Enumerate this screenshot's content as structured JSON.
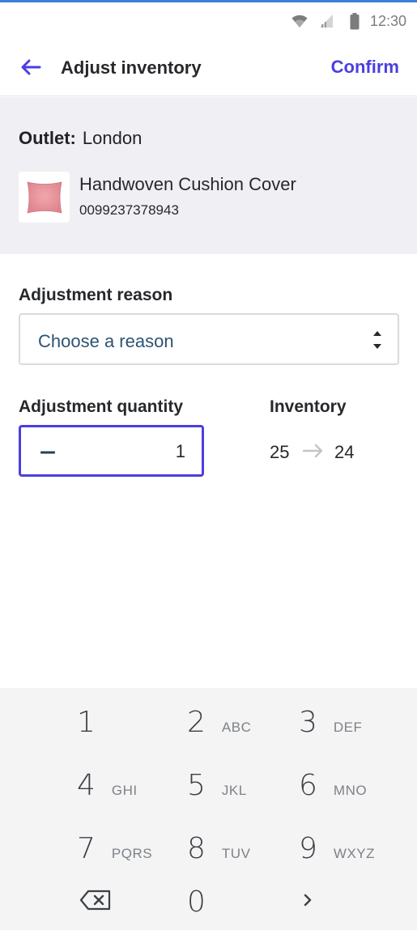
{
  "status_bar": {
    "time": "12:30",
    "icons": [
      "wifi-icon",
      "signal-icon",
      "battery-icon"
    ]
  },
  "app_bar": {
    "title": "Adjust inventory",
    "confirm_label": "Confirm",
    "back_icon": "back-arrow-icon"
  },
  "product": {
    "outlet_label": "Outlet:",
    "outlet_value": "London",
    "name": "Handwoven Cushion Cover",
    "sku": "0099237378943"
  },
  "adjustment_reason": {
    "label": "Adjustment reason",
    "placeholder": "Choose a reason"
  },
  "adjustment_quantity": {
    "label": "Adjustment quantity",
    "value": "1"
  },
  "inventory": {
    "label": "Inventory",
    "from": "25",
    "to": "24"
  },
  "keypad": {
    "keys": [
      {
        "num": "1",
        "letters": ""
      },
      {
        "num": "2",
        "letters": "ABC"
      },
      {
        "num": "3",
        "letters": "DEF"
      },
      {
        "num": "4",
        "letters": "GHI"
      },
      {
        "num": "5",
        "letters": "JKL"
      },
      {
        "num": "6",
        "letters": "MNO"
      },
      {
        "num": "7",
        "letters": "PQRS"
      },
      {
        "num": "8",
        "letters": "TUV"
      },
      {
        "num": "9",
        "letters": "WXYZ"
      },
      {
        "num": "0",
        "letters": ""
      }
    ],
    "backspace_icon": "backspace-icon",
    "next_icon": "chevron-right-icon"
  },
  "colors": {
    "accent": "#4b3fe0",
    "panel_bg": "#f0eff3",
    "keypad_bg": "#f4f4f5",
    "placeholder_text": "#2d5373"
  }
}
